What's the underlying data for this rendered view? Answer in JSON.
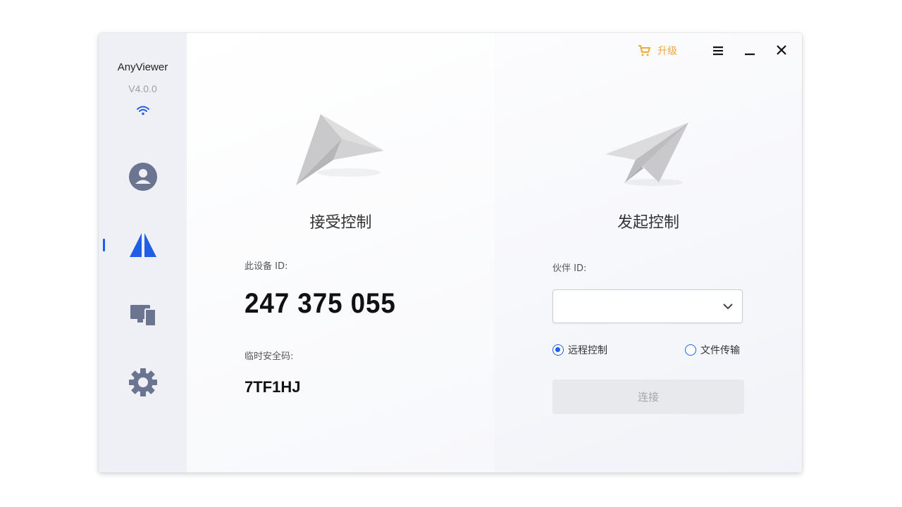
{
  "app": {
    "name": "AnyViewer",
    "version": "V4.0.0"
  },
  "sidebar": {
    "items": [
      {
        "icon": "user-icon",
        "active": false
      },
      {
        "icon": "remote-control-icon",
        "active": true
      },
      {
        "icon": "devices-icon",
        "active": false
      },
      {
        "icon": "gear-icon",
        "active": false
      }
    ]
  },
  "titlebar": {
    "upgrade_label": "升级",
    "menu_icon": "hamburger-menu-icon",
    "minimize_icon": "minimize-icon",
    "close_icon": "close-icon"
  },
  "receive": {
    "title": "接受控制",
    "device_id_label": "此设备 ID:",
    "device_id": "247 375 055",
    "temp_code_label": "临时安全码:",
    "temp_code": "7TF1HJ"
  },
  "initiate": {
    "title": "发起控制",
    "partner_id_label": "伙伴 ID:",
    "partner_id_value": "",
    "mode_options": [
      {
        "label": "远程控制",
        "checked": true
      },
      {
        "label": "文件传输",
        "checked": false
      }
    ],
    "connect_label": "连接"
  },
  "colors": {
    "accent": "#1f5fe6",
    "upgrade": "#f0a93b",
    "sidebar_bg": "#eef0f5",
    "disabled_button": "#e8e9ed"
  }
}
